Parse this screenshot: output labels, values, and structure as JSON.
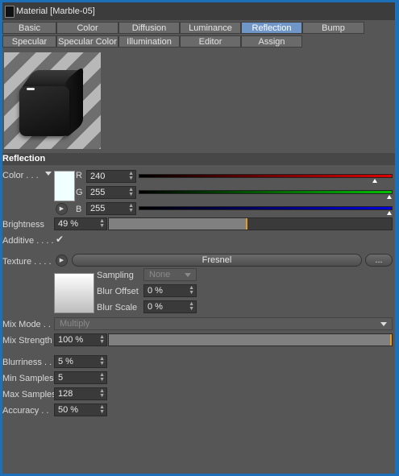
{
  "window": {
    "title": "Material [Marble-05]"
  },
  "tabs_row1": [
    "Basic",
    "Color",
    "Diffusion",
    "Luminance",
    "Reflection",
    "Bump"
  ],
  "tabs_row2": [
    "Specular",
    "Specular Color",
    "Illumination",
    "Editor",
    "Assign"
  ],
  "active_tab": "Reflection",
  "section": {
    "title": "Reflection"
  },
  "color": {
    "label": "Color . . .",
    "swatch": "#f0ffff",
    "r": {
      "label": "R",
      "value": "240",
      "fraction": 0.941,
      "color": "#d00000"
    },
    "g": {
      "label": "G",
      "value": "255",
      "fraction": 1.0,
      "color": "#00b000"
    },
    "b": {
      "label": "B",
      "value": "255",
      "fraction": 1.0,
      "color": "#0000d0"
    }
  },
  "brightness": {
    "label": "Brightness",
    "value": "49 %",
    "fraction": 0.49
  },
  "additive": {
    "label": "Additive . . . .",
    "checked": true
  },
  "texture": {
    "label": "Texture . . . .",
    "shader": "Fresnel",
    "more": "..."
  },
  "sampling": {
    "label": "Sampling",
    "value": "None"
  },
  "blur_offset": {
    "label": "Blur Offset",
    "value": "0 %"
  },
  "blur_scale": {
    "label": "Blur Scale",
    "value": "0 %"
  },
  "mix_mode": {
    "label": "Mix Mode . . .",
    "value": "Multiply"
  },
  "mix_strength": {
    "label": "Mix Strength",
    "value": "100 %",
    "fraction": 1.0
  },
  "blurriness": {
    "label": "Blurriness . .",
    "value": "5 %"
  },
  "min_samples": {
    "label": "Min Samples",
    "value": "5"
  },
  "max_samples": {
    "label": "Max Samples",
    "value": "128"
  },
  "accuracy": {
    "label": "Accuracy . .",
    "value": "50 %"
  },
  "colors": {
    "accent": "#7096c8",
    "window_border": "#1d6fb8",
    "panel": "#565656",
    "slider_tick": "#e49b28"
  }
}
